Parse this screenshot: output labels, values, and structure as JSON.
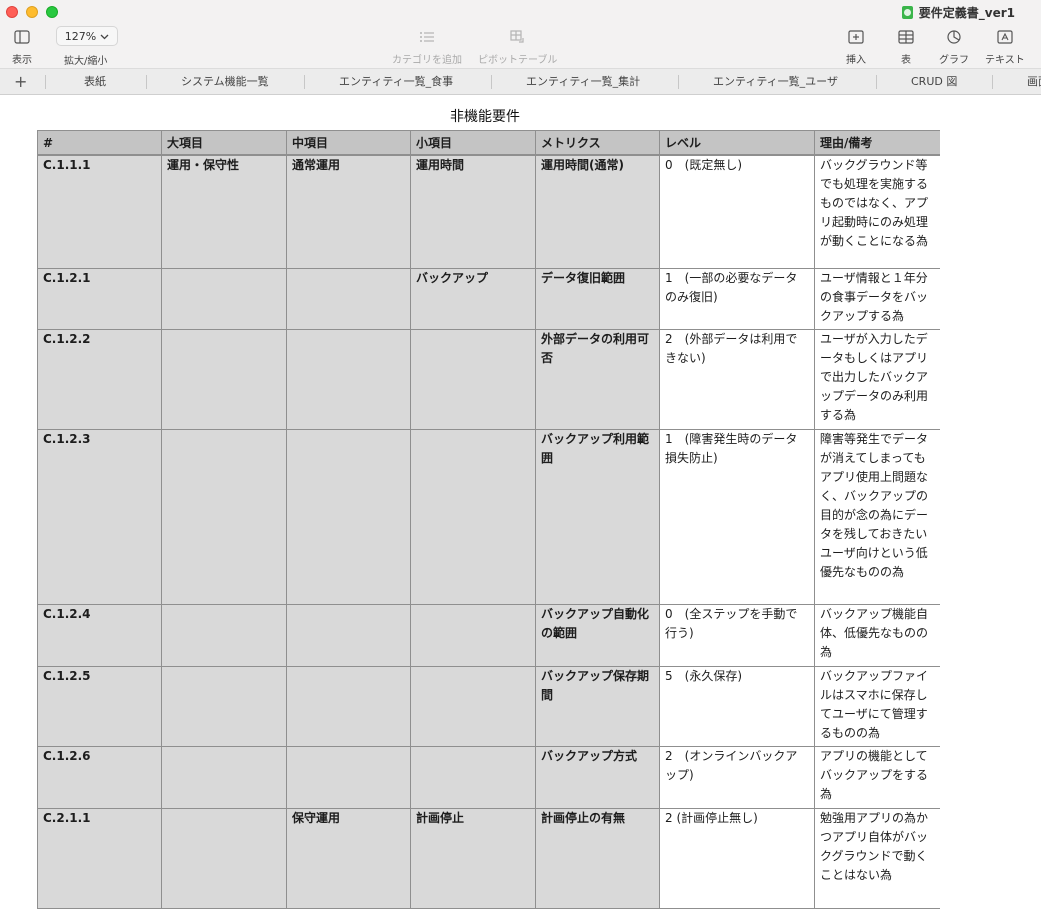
{
  "window": {
    "document_title": "要件定義書_ver1"
  },
  "toolbar": {
    "view_label": "表示",
    "zoom_value": "127%",
    "zoom_label": "拡大/縮小",
    "add_category_label": "カテゴリを追加",
    "pivot_table_label": "ピボットテーブル",
    "insert_label": "挿入",
    "table_label": "表",
    "chart_label": "グラフ",
    "text_label": "テキスト"
  },
  "tabs": {
    "add_label": "+",
    "items": [
      "表紙",
      "システム機能一覧",
      "エンティティ一覧_食事",
      "エンティティ一覧_集計",
      "エンティティ一覧_ユーザ",
      "CRUD 図",
      "画面"
    ]
  },
  "sheet": {
    "title": "非機能要件",
    "headers": [
      "#",
      "大項目",
      "中項目",
      "小項目",
      "メトリクス",
      "レベル",
      "理由/備考"
    ],
    "rows": [
      {
        "id": "C.1.1.1",
        "major": "運用・保守性",
        "middle": "通常運用",
        "minor": "運用時間",
        "metric": "運用時間(通常)",
        "level": "0　(既定無し)",
        "reason": "バックグラウンド等でも処理を実施するものではなく、アプリ起動時にのみ処理が動くことになる為"
      },
      {
        "id": "C.1.2.1",
        "major": "",
        "middle": "",
        "minor": "バックアップ",
        "metric": "データ復旧範囲",
        "level": "1　(一部の必要なデータのみ復旧)",
        "reason": "ユーザ情報と１年分の食事データをバックアップする為"
      },
      {
        "id": "C.1.2.2",
        "major": "",
        "middle": "",
        "minor": "",
        "metric": "外部データの利用可否",
        "level": "2　(外部データは利用できない)",
        "reason": "ユーザが入力したデータもしくはアプリで出力したバックアップデータのみ利用する為"
      },
      {
        "id": "C.1.2.3",
        "major": "",
        "middle": "",
        "minor": "",
        "metric": "バックアップ利用範囲",
        "level": "1　(障害発生時のデータ損失防止)",
        "reason": "障害等発生でデータが消えてしまってもアプリ使用上問題なく、バックアップの目的が念の為にデータを残しておきたいユーザ向けという低優先なものの為"
      },
      {
        "id": "C.1.2.4",
        "major": "",
        "middle": "",
        "minor": "",
        "metric": "バックアップ自動化の範囲",
        "level": "0　(全ステップを手動で行う)",
        "reason": "バックアップ機能自体、低優先なものの為"
      },
      {
        "id": "C.1.2.5",
        "major": "",
        "middle": "",
        "minor": "",
        "metric": "バックアップ保存期間",
        "level": "5　(永久保存)",
        "reason": "バックアップファイルはスマホに保存してユーザにて管理するものの為"
      },
      {
        "id": "C.1.2.6",
        "major": "",
        "middle": "",
        "minor": "",
        "metric": "バックアップ方式",
        "level": "2　(オンラインバックアップ)",
        "reason": "アプリの機能としてバックアップをする為"
      },
      {
        "id": "C.2.1.1",
        "major": "",
        "middle": "保守運用",
        "minor": "計画停止",
        "metric": "計画停止の有無",
        "level": "2 (計画停止無し)",
        "reason": "勉強用アプリの為かつアプリ自体がバックグラウンドで動くことはない為"
      }
    ]
  }
}
